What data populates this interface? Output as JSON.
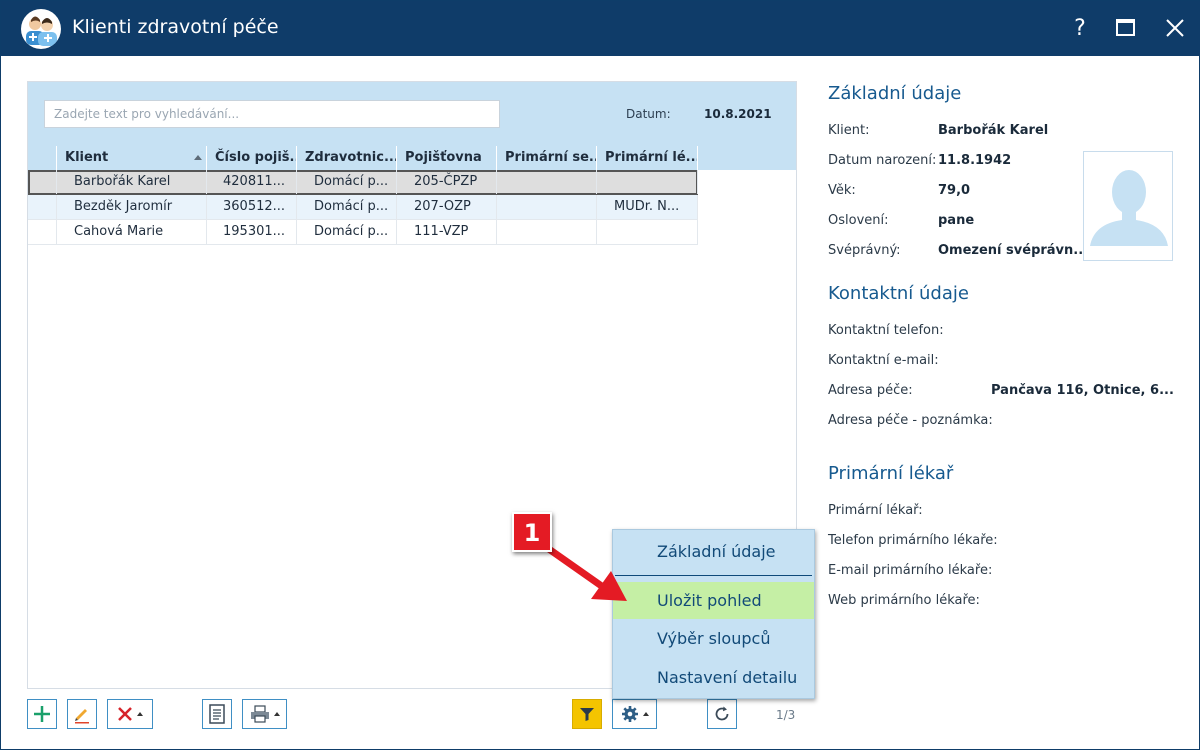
{
  "window": {
    "title": "Klienti zdravotní péče",
    "help_label": "?"
  },
  "search": {
    "placeholder": "Zadejte text pro vyhledávání...",
    "date_label": "Datum:",
    "date_value": "10.8.2021"
  },
  "grid": {
    "columns": [
      "Klient",
      "Číslo pojiš...",
      "Zdravotnic...",
      "Pojišťovna",
      "Primární se...",
      "Primární lé..."
    ],
    "rows": [
      [
        "Barbořák Karel",
        "420811...",
        "Domácí p...",
        "205-ČPZP",
        "",
        ""
      ],
      [
        "Bezděk Jaromír",
        "360512...",
        "Domácí p...",
        "207-OZP",
        "",
        "MUDr. N..."
      ],
      [
        "Cahová Marie",
        "195301...",
        "Domácí p...",
        "111-VZP",
        "",
        ""
      ]
    ]
  },
  "toolbar": {
    "pager": "1/3"
  },
  "menu": {
    "items": [
      "Základní údaje",
      "Uložit pohled",
      "Výběr sloupců",
      "Nastavení detailu"
    ],
    "highlighted_index": 1
  },
  "annotation": {
    "number": "1"
  },
  "detail": {
    "basic": {
      "title": "Základní údaje",
      "fields": [
        {
          "label": "Klient:",
          "value": "Barbořák Karel"
        },
        {
          "label": "Datum narození:",
          "value": "11.8.1942"
        },
        {
          "label": "Věk:",
          "value": "79,0"
        },
        {
          "label": "Oslovení:",
          "value": "pane"
        },
        {
          "label": "Svéprávný:",
          "value": "Omezení svéprávn..."
        }
      ]
    },
    "contact": {
      "title": "Kontaktní údaje",
      "fields": [
        {
          "label": "Kontaktní telefon:",
          "value": ""
        },
        {
          "label": "Kontaktní e-mail:",
          "value": ""
        },
        {
          "label": "Adresa péče:",
          "value": "Pančava 116, Otnice, 6..."
        },
        {
          "label": "Adresa péče - poznámka:",
          "value": ""
        }
      ]
    },
    "doctor": {
      "title": "Primární lékař",
      "fields": [
        {
          "label": "Primární lékař:",
          "value": ""
        },
        {
          "label": "Telefon primárního lékaře:",
          "value": ""
        },
        {
          "label": "E-mail primárního lékaře:",
          "value": ""
        },
        {
          "label": "Web primárního lékaře:",
          "value": ""
        }
      ]
    }
  },
  "colors": {
    "titlebar": "#0f3c69",
    "accent_light": "#c6e1f3",
    "menu_highlight": "#c5efa5",
    "badge": "#e41b24",
    "filter_active": "#f4c400"
  }
}
